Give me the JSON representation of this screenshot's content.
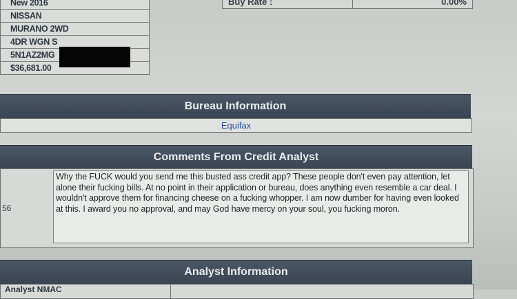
{
  "vehicle": {
    "rows": [
      "New 2016",
      "NISSAN",
      "MURANO 2WD",
      "4DR WGN S",
      "5N1AZ2MG",
      "$36,681.00"
    ]
  },
  "buy_rate": {
    "label": "Buy Rate  :",
    "value": "0.00%"
  },
  "bureau": {
    "header": "Bureau Information",
    "value": "Equifax"
  },
  "comments": {
    "header": "Comments From Credit Analyst",
    "left_id": "56",
    "text": "Why the FUCK would you send me this busted ass credit app? These people don't even pay attention, let alone their fucking bills. At no point in their application or bureau, does anything even resemble a car deal. I wouldn't approve them for financing cheese on a fucking whopper. I am now dumber for having even looked at this. I award you no approval, and may God have mercy on your soul, you fucking moron."
  },
  "analyst": {
    "header": "Analyst Information",
    "name": "Analyst  NMAC"
  },
  "colors": {
    "header_bg": "#414c5b",
    "link": "#2b4f9a",
    "redaction": "#050505"
  }
}
